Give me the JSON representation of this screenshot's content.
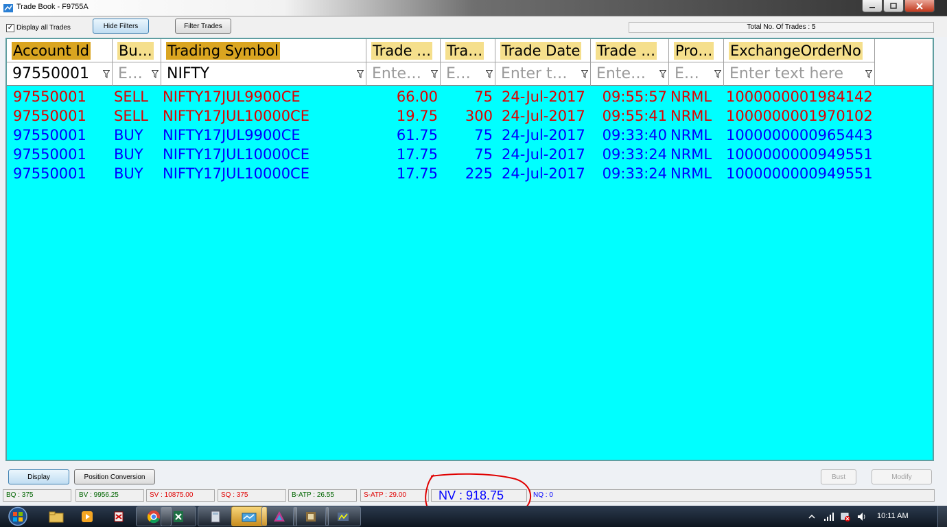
{
  "window": {
    "title": "Trade Book - F9755A"
  },
  "toolbar": {
    "display_all_label": "Display all Trades",
    "display_all_checked": "✓",
    "hide_filters_label": "Hide Filters",
    "filter_trades_label": "Filter Trades",
    "total_label": "Total No. Of Trades : 5"
  },
  "columns": [
    {
      "label": "Account Id"
    },
    {
      "label": "Bu…"
    },
    {
      "label": "Trading Symbol"
    },
    {
      "label": "Trade …"
    },
    {
      "label": "Tra…"
    },
    {
      "label": "Trade Date"
    },
    {
      "label": "Trade …"
    },
    {
      "label": "Pro…"
    },
    {
      "label": "ExchangeOrderNo"
    }
  ],
  "filters": [
    {
      "value": "97550001"
    },
    {
      "placeholder": "E…"
    },
    {
      "value": "NIFTY"
    },
    {
      "placeholder": "Ente…"
    },
    {
      "placeholder": "E…"
    },
    {
      "placeholder": "Enter t…"
    },
    {
      "placeholder": "Ente…"
    },
    {
      "placeholder": "E…"
    },
    {
      "placeholder": "Enter text here"
    }
  ],
  "rows": [
    [
      "97550001",
      "SELL",
      "NIFTY17JUL9900CE",
      "66.00",
      "75",
      "24-Jul-2017",
      "09:55:57",
      "NRML",
      "1000000001984142"
    ],
    [
      "97550001",
      "SELL",
      "NIFTY17JUL10000CE",
      "19.75",
      "300",
      "24-Jul-2017",
      "09:55:41",
      "NRML",
      "1000000001970102"
    ],
    [
      "97550001",
      "BUY",
      "NIFTY17JUL9900CE",
      "61.75",
      "75",
      "24-Jul-2017",
      "09:33:40",
      "NRML",
      "1000000000965443"
    ],
    [
      "97550001",
      "BUY",
      "NIFTY17JUL10000CE",
      "17.75",
      "75",
      "24-Jul-2017",
      "09:33:24",
      "NRML",
      "1000000000949551"
    ],
    [
      "97550001",
      "BUY",
      "NIFTY17JUL10000CE",
      "17.75",
      "225",
      "24-Jul-2017",
      "09:33:24",
      "NRML",
      "1000000000949551"
    ]
  ],
  "buttons": {
    "display": "Display",
    "position_conversion": "Position Conversion",
    "bust": "Bust",
    "modify": "Modify"
  },
  "status": {
    "bq": "BQ : 375",
    "bv": "BV : 9956.25",
    "sv": "SV : 10875.00",
    "sq": "SQ : 375",
    "batp": "B-ATP : 26.55",
    "satp": "S-ATP : 29.00",
    "nv": "NV : 918.75",
    "nq": "NQ : 0"
  },
  "colors": {
    "grid_bg": "#00ffff",
    "sell": "#e00000",
    "buy": "#0000ff",
    "header_highlight": "#f5df8c",
    "annotation": "#e00000"
  },
  "taskbar": {
    "icons": [
      "start-orb",
      "file-explorer",
      "media-player",
      "app-icon",
      "chrome",
      "excel",
      "calculator",
      "folder",
      "app-icon",
      "app-icon",
      "app-icon"
    ],
    "clock": "10:11 AM"
  }
}
